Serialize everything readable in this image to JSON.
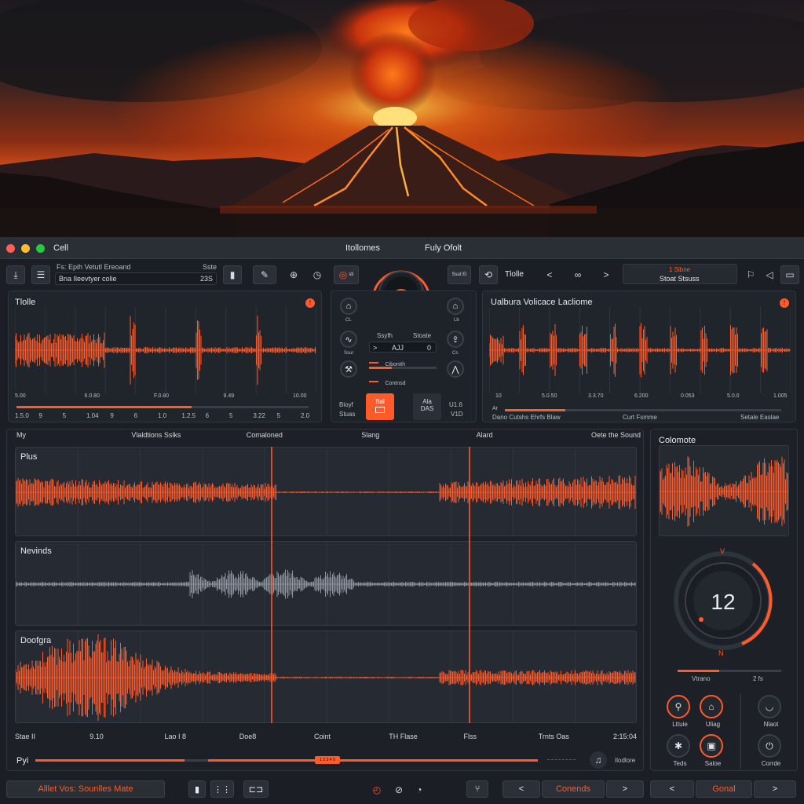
{
  "colors": {
    "accent": "#ff5a2a",
    "wave_gray": "#8f96a0",
    "panel": "#20252c"
  },
  "titlebar": {
    "title": "Cell",
    "menu1": "Itollomes",
    "menu2": "Fuly Ofolt"
  },
  "toolbar": {
    "file_line1": "Fs: Epih Vetutl Ereoand",
    "file_line1_right": "Sste",
    "file_field": "Bna Ileevtyer colie",
    "file_field_value": "23S",
    "mini_label": "sti",
    "mini_label2": "Ssut Ei",
    "tools_label": "Tlolle",
    "display_line1": "1 Slbne",
    "display_line2": "Stoat Stsuss"
  },
  "left_panel": {
    "title": "Tlolle",
    "ticks": [
      "5.00",
      "6.0.80",
      "F.0.80",
      "9.49",
      "10.00"
    ],
    "bottom_ticks": [
      "1.5.0",
      "9",
      "5",
      "1.04",
      "9",
      "6",
      "1.0",
      "1.2.5",
      "6",
      "5",
      "3.22",
      "5",
      "2.0"
    ]
  },
  "center": {
    "btn_labels": [
      "CL",
      "Lb",
      "Ssur",
      "Cs"
    ],
    "s_label": "Ssyfh",
    "s_label2": "Stoate",
    "field_value": "AJJ",
    "field_num": "0",
    "slider1": "Cibonith",
    "slider2": "Contnsd",
    "left_text1": "Bioyf",
    "left_text2": "Stuas",
    "card1": "Bal",
    "card2_line1": "Ala",
    "card2_line2": "DAS",
    "right_text1": "U1.6",
    "right_text2": "V1D"
  },
  "right_panel": {
    "title": "Ualbura Volicace Lacliome",
    "ticks": [
      "10",
      "5.0.50",
      "3.3.70",
      "6.200",
      "0.053",
      "5.0.0",
      "1.005"
    ],
    "left_marker": "Ar",
    "bottom_left": "Dano Cutshs Ehrfs Blaw",
    "bottom_mid": "Curt Fsmme",
    "bottom_right": "Setale Easlae"
  },
  "tracks": {
    "header": [
      "My",
      "Vlaldtions Sslks",
      "Comaloned",
      "Slang",
      "Alard",
      "Oete the Sound"
    ],
    "items": [
      {
        "name": "Plus"
      },
      {
        "name": "Nevinds"
      },
      {
        "name": "Doofgra"
      }
    ],
    "footer": [
      "Stae II",
      "9.10",
      "Lao I 8",
      "Doe8",
      "Coint",
      "TH Flase",
      "Flss",
      "Trnts Oas",
      "2:15:04"
    ],
    "scrub_left": "Pyi",
    "scrub_badge": "1 2 3 4 5",
    "scrub_right": "Ilodlore"
  },
  "side": {
    "title": "Colomote",
    "dial_value": "12",
    "dial_top": "V",
    "dial_bottom": "N",
    "slider_left": "Vtrano",
    "slider_right": "2 fs",
    "knobs": [
      {
        "label": "Lttuie",
        "icon": "⚲"
      },
      {
        "label": "Uliag",
        "icon": "⌂"
      },
      {
        "label": "Nlaot",
        "icon": "◡"
      },
      {
        "label": "Teds",
        "icon": "✱"
      },
      {
        "label": "Saloe",
        "icon": "▣"
      },
      {
        "label": "Corrde",
        "icon": "⏻"
      }
    ]
  },
  "bottombar": {
    "status": "Alllet Vos: Sounlles Mate",
    "nav1": "Conends",
    "nav2": "Gonal"
  }
}
